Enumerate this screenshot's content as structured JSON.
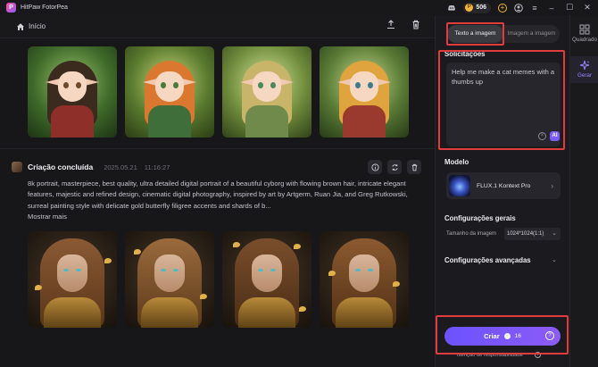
{
  "app": {
    "title": "HitPaw FotorPea",
    "credits": "506"
  },
  "colors": {
    "accent": "#7b5cff",
    "highlight": "#e23b3b",
    "background": "#161618"
  },
  "header": {
    "home_label": "Início"
  },
  "creation": {
    "title": "Criação concluída",
    "date": "2025.05.21",
    "time": "11:16:27",
    "prompt": "8k portrait, masterpiece, best quality, ultra detailed digital portrait of a beautiful cyborg with flowing brown hair, intricate elegant features, majestic and refined design, cinematic digital photography, inspired by art by Artgerm, Ruan Jia, and Greg Rutkowski, surreal painting style with delicate gold butterfly filigree accents and shards of b...",
    "show_more": "Mostrar mais"
  },
  "panel": {
    "tabs": [
      {
        "label": "Texto a imagem"
      },
      {
        "label": "Imagem a imagem"
      }
    ],
    "prompt_label": "Solicitações",
    "prompt_value": "Help me make a cat memes with a thumbs up",
    "ai_badge": "AI",
    "model_label": "Modelo",
    "model_name": "FLUX.1 Kontext Pro",
    "general_label": "Configurações gerais",
    "size_label": "Tamanho da imagem",
    "size_value": "1024*1024(1:1)",
    "advanced_label": "Configurações avançadas",
    "create_label": "Criar",
    "create_cost": "16",
    "disclaimer": "Isenção de responsabilidade"
  },
  "rail": {
    "items": [
      {
        "label": "Quadrado"
      },
      {
        "label": "Gerar"
      }
    ]
  }
}
